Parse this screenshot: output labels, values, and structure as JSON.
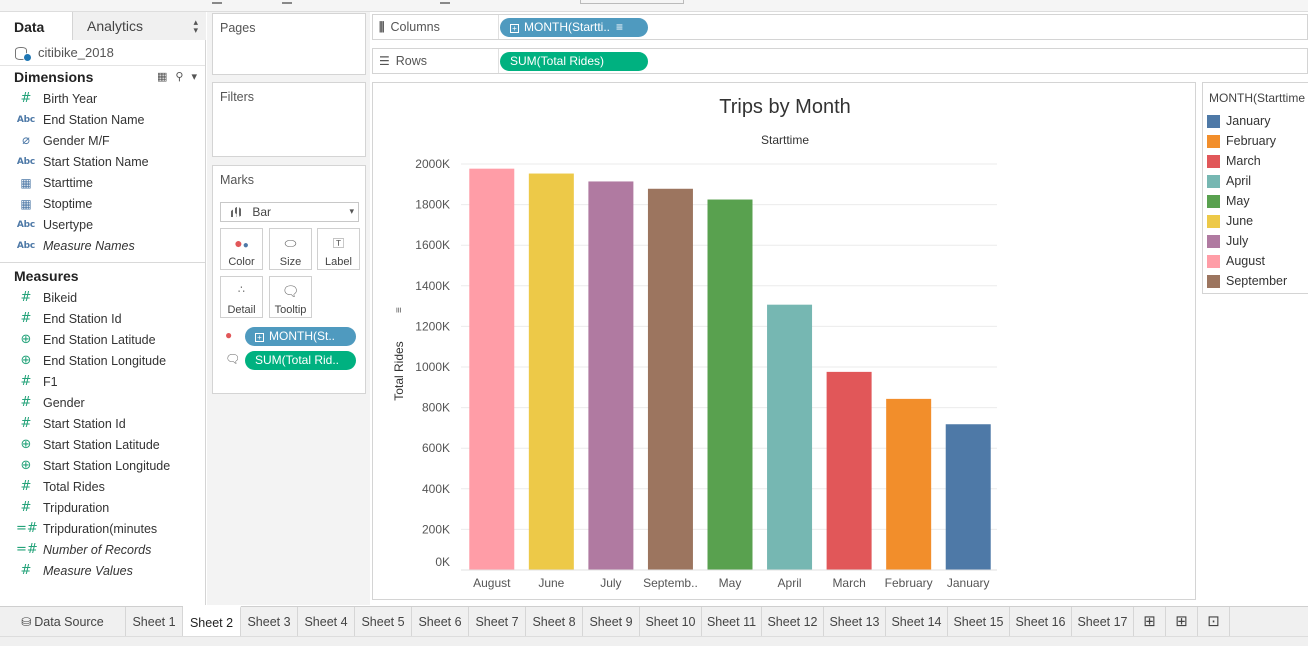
{
  "left_panel": {
    "tabs": {
      "data": "Data",
      "analytics": "Analytics"
    },
    "datasource": "citibike_2018",
    "dimensions_title": "Dimensions",
    "dimensions": [
      {
        "label": "Birth Year",
        "type": "number"
      },
      {
        "label": "End Station Name",
        "type": "string"
      },
      {
        "label": "Gender M/F",
        "type": "group"
      },
      {
        "label": "Start Station Name",
        "type": "string"
      },
      {
        "label": "Starttime",
        "type": "datetime"
      },
      {
        "label": "Stoptime",
        "type": "datetime"
      },
      {
        "label": "Usertype",
        "type": "string"
      },
      {
        "label": "Measure Names",
        "type": "string",
        "italic": true
      }
    ],
    "measures_title": "Measures",
    "measures": [
      {
        "label": "Bikeid",
        "type": "number"
      },
      {
        "label": "End Station Id",
        "type": "number"
      },
      {
        "label": "End Station Latitude",
        "type": "geo"
      },
      {
        "label": "End Station Longitude",
        "type": "geo"
      },
      {
        "label": "F1",
        "type": "number"
      },
      {
        "label": "Gender",
        "type": "number"
      },
      {
        "label": "Start Station Id",
        "type": "number"
      },
      {
        "label": "Start Station Latitude",
        "type": "geo"
      },
      {
        "label": "Start Station Longitude",
        "type": "geo"
      },
      {
        "label": "Total Rides",
        "type": "number"
      },
      {
        "label": "Tripduration",
        "type": "number"
      },
      {
        "label": "Tripduration(minutes",
        "type": "calc"
      },
      {
        "label": "Number of Records",
        "type": "calc",
        "italic": true
      },
      {
        "label": "Measure Values",
        "type": "number",
        "italic": true
      }
    ]
  },
  "cards": {
    "pages": "Pages",
    "filters": "Filters",
    "marks": "Marks",
    "mark_type": "Bar",
    "mark_buttons": {
      "color": "Color",
      "size": "Size",
      "label": "Label",
      "detail": "Detail",
      "tooltip": "Tooltip"
    },
    "mark_pills": {
      "color_pill": "MONTH(St..",
      "tooltip_pill": "SUM(Total Rid.."
    }
  },
  "shelves": {
    "columns_label": "Columns",
    "columns_pill": "MONTH(Startti..",
    "rows_label": "Rows",
    "rows_pill": "SUM(Total Rides)"
  },
  "chart_data": {
    "type": "bar",
    "title": "Trips by Month",
    "column_header": "Starttime",
    "ylabel": "Total Rides",
    "xlabel": "",
    "categories": [
      "August",
      "June",
      "July",
      "Septemb..",
      "May",
      "April",
      "March",
      "February",
      "January"
    ],
    "values": [
      1977000,
      1953000,
      1914000,
      1878000,
      1825000,
      1307000,
      976000,
      843000,
      718000
    ],
    "colors": [
      "#ff9da7",
      "#edc948",
      "#b07aa1",
      "#9c755f",
      "#59a14f",
      "#76b7b2",
      "#e15759",
      "#f28e2b",
      "#4e79a7"
    ],
    "ylim": [
      0,
      2000000
    ],
    "yticks": [
      0,
      200000,
      400000,
      600000,
      800000,
      1000000,
      1200000,
      1400000,
      1600000,
      1800000,
      2000000
    ],
    "ytick_labels": [
      "0K",
      "200K",
      "400K",
      "600K",
      "800K",
      "1000K",
      "1200K",
      "1400K",
      "1600K",
      "1800K",
      "2000K"
    ],
    "grid": true
  },
  "legend": {
    "title": "MONTH(Starttime",
    "items": [
      {
        "label": "January",
        "color": "#4e79a7"
      },
      {
        "label": "February",
        "color": "#f28e2b"
      },
      {
        "label": "March",
        "color": "#e15759"
      },
      {
        "label": "April",
        "color": "#76b7b2"
      },
      {
        "label": "May",
        "color": "#59a14f"
      },
      {
        "label": "June",
        "color": "#edc948"
      },
      {
        "label": "July",
        "color": "#b07aa1"
      },
      {
        "label": "August",
        "color": "#ff9da7"
      },
      {
        "label": "September",
        "color": "#9c755f"
      }
    ]
  },
  "sheet_tabs": {
    "data_source": "Data Source",
    "sheets": [
      "Sheet 1",
      "Sheet 2",
      "Sheet 3",
      "Sheet 4",
      "Sheet 5",
      "Sheet 6",
      "Sheet 7",
      "Sheet 8",
      "Sheet 9",
      "Sheet 10",
      "Sheet 11",
      "Sheet 12",
      "Sheet 13",
      "Sheet 14",
      "Sheet 15",
      "Sheet 16",
      "Sheet 17"
    ],
    "active": "Sheet 2"
  }
}
